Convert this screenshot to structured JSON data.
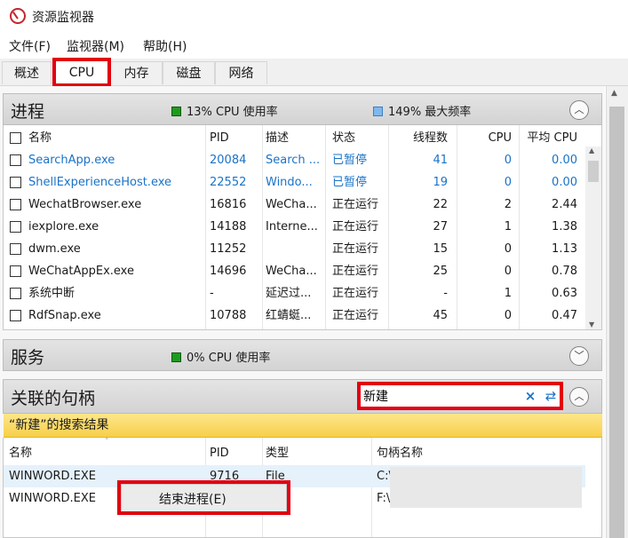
{
  "window": {
    "title": "资源监视器"
  },
  "menu": [
    "文件(F)",
    "监视器(M)",
    "帮助(H)"
  ],
  "tabs": [
    {
      "label": "概述"
    },
    {
      "label": "CPU",
      "active": true
    },
    {
      "label": "内存"
    },
    {
      "label": "磁盘"
    },
    {
      "label": "网络"
    }
  ],
  "processes": {
    "title": "进程",
    "cpu_usage": "13% CPU 使用率",
    "max_freq": "149% 最大频率",
    "columns": [
      "名称",
      "PID",
      "描述",
      "状态",
      "线程数",
      "CPU",
      "平均 CPU"
    ],
    "rows": [
      {
        "name": "SearchApp.exe",
        "pid": "20084",
        "desc": "Search ...",
        "status": "已暂停",
        "threads": "41",
        "cpu": "0",
        "avg": "0.00",
        "suspended": true
      },
      {
        "name": "ShellExperienceHost.exe",
        "pid": "22552",
        "desc": "Windo...",
        "status": "已暂停",
        "threads": "19",
        "cpu": "0",
        "avg": "0.00",
        "suspended": true
      },
      {
        "name": "WechatBrowser.exe",
        "pid": "16816",
        "desc": "WeCha...",
        "status": "正在运行",
        "threads": "22",
        "cpu": "2",
        "avg": "2.44"
      },
      {
        "name": "iexplore.exe",
        "pid": "14188",
        "desc": "Interne...",
        "status": "正在运行",
        "threads": "27",
        "cpu": "1",
        "avg": "1.38"
      },
      {
        "name": "dwm.exe",
        "pid": "11252",
        "desc": "",
        "status": "正在运行",
        "threads": "15",
        "cpu": "0",
        "avg": "1.13"
      },
      {
        "name": "WeChatAppEx.exe",
        "pid": "14696",
        "desc": "WeCha...",
        "status": "正在运行",
        "threads": "25",
        "cpu": "0",
        "avg": "0.78"
      },
      {
        "name": "系统中断",
        "pid": "-",
        "desc": "延迟过...",
        "status": "正在运行",
        "threads": "-",
        "cpu": "1",
        "avg": "0.63"
      },
      {
        "name": "RdfSnap.exe",
        "pid": "10788",
        "desc": "红蜻蜓...",
        "status": "正在运行",
        "threads": "45",
        "cpu": "0",
        "avg": "0.47"
      }
    ]
  },
  "services": {
    "title": "服务",
    "cpu_usage": "0% CPU 使用率"
  },
  "handles": {
    "title": "关联的句柄",
    "search_value": "新建",
    "result_label": "“新建”的搜索结果",
    "columns": [
      "名称",
      "PID",
      "类型",
      "句柄名称"
    ],
    "rows": [
      {
        "name": "WINWORD.EXE",
        "pid": "9716",
        "type": "File",
        "handle": "C:\\"
      },
      {
        "name": "WINWORD.EXE",
        "pid": "",
        "type": "",
        "handle": "F:\\"
      }
    ]
  },
  "context_menu": {
    "item": "结束进程(E)"
  },
  "colors": {
    "accent_blue": "#1a73c7",
    "highlight_red": "#e2000f",
    "result_yellow": "#f7cf4a"
  },
  "icons": {
    "app": "resource-monitor-icon",
    "collapse": "chevron-up-icon",
    "expand": "chevron-down-icon",
    "clear": "close-icon",
    "refresh": "refresh-icon"
  }
}
